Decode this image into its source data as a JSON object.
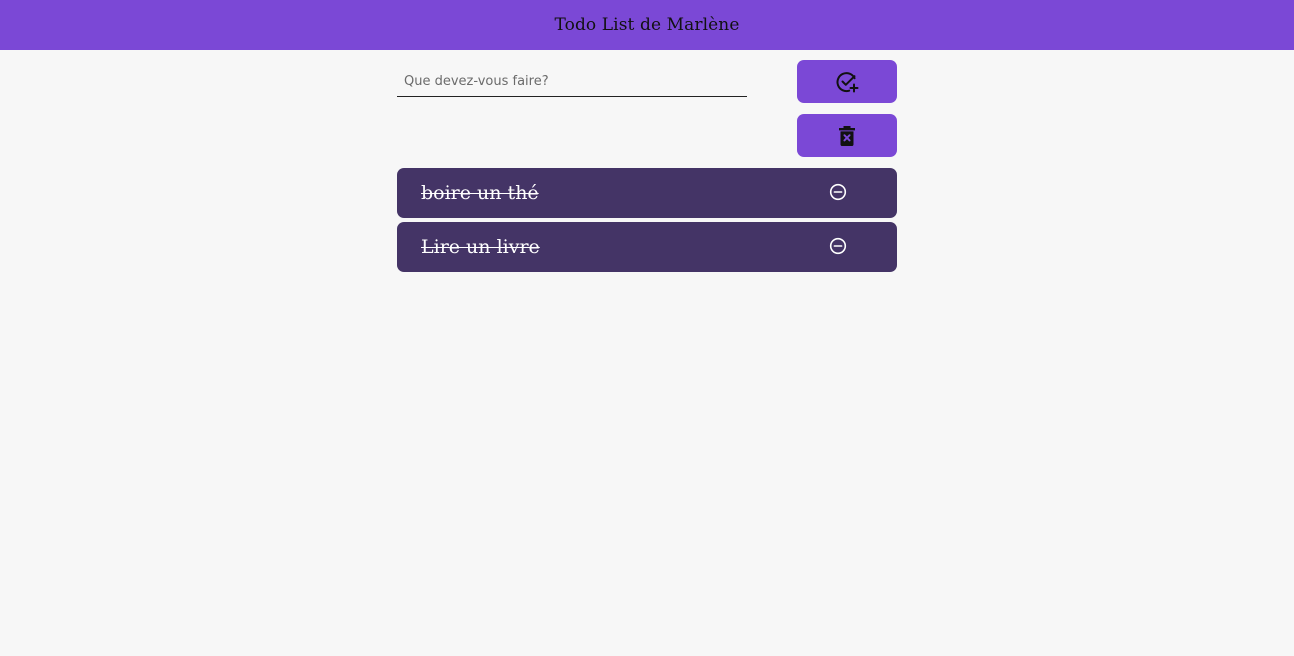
{
  "header": {
    "title": "Todo List de Marlène"
  },
  "form": {
    "input_placeholder": "Que devez-vous faire?",
    "input_value": "",
    "add_button_icon": "circle-check-plus-icon",
    "clear_button_icon": "trash-x-icon"
  },
  "todos": [
    {
      "text": "boire un thé",
      "completed": true,
      "remove_icon": "circle-minus-icon"
    },
    {
      "text": "Lire un livre",
      "completed": true,
      "remove_icon": "circle-minus-icon"
    }
  ],
  "colors": {
    "accent": "#7b48d6",
    "todo_background": "#443466",
    "page_background": "#f7f7f7"
  }
}
